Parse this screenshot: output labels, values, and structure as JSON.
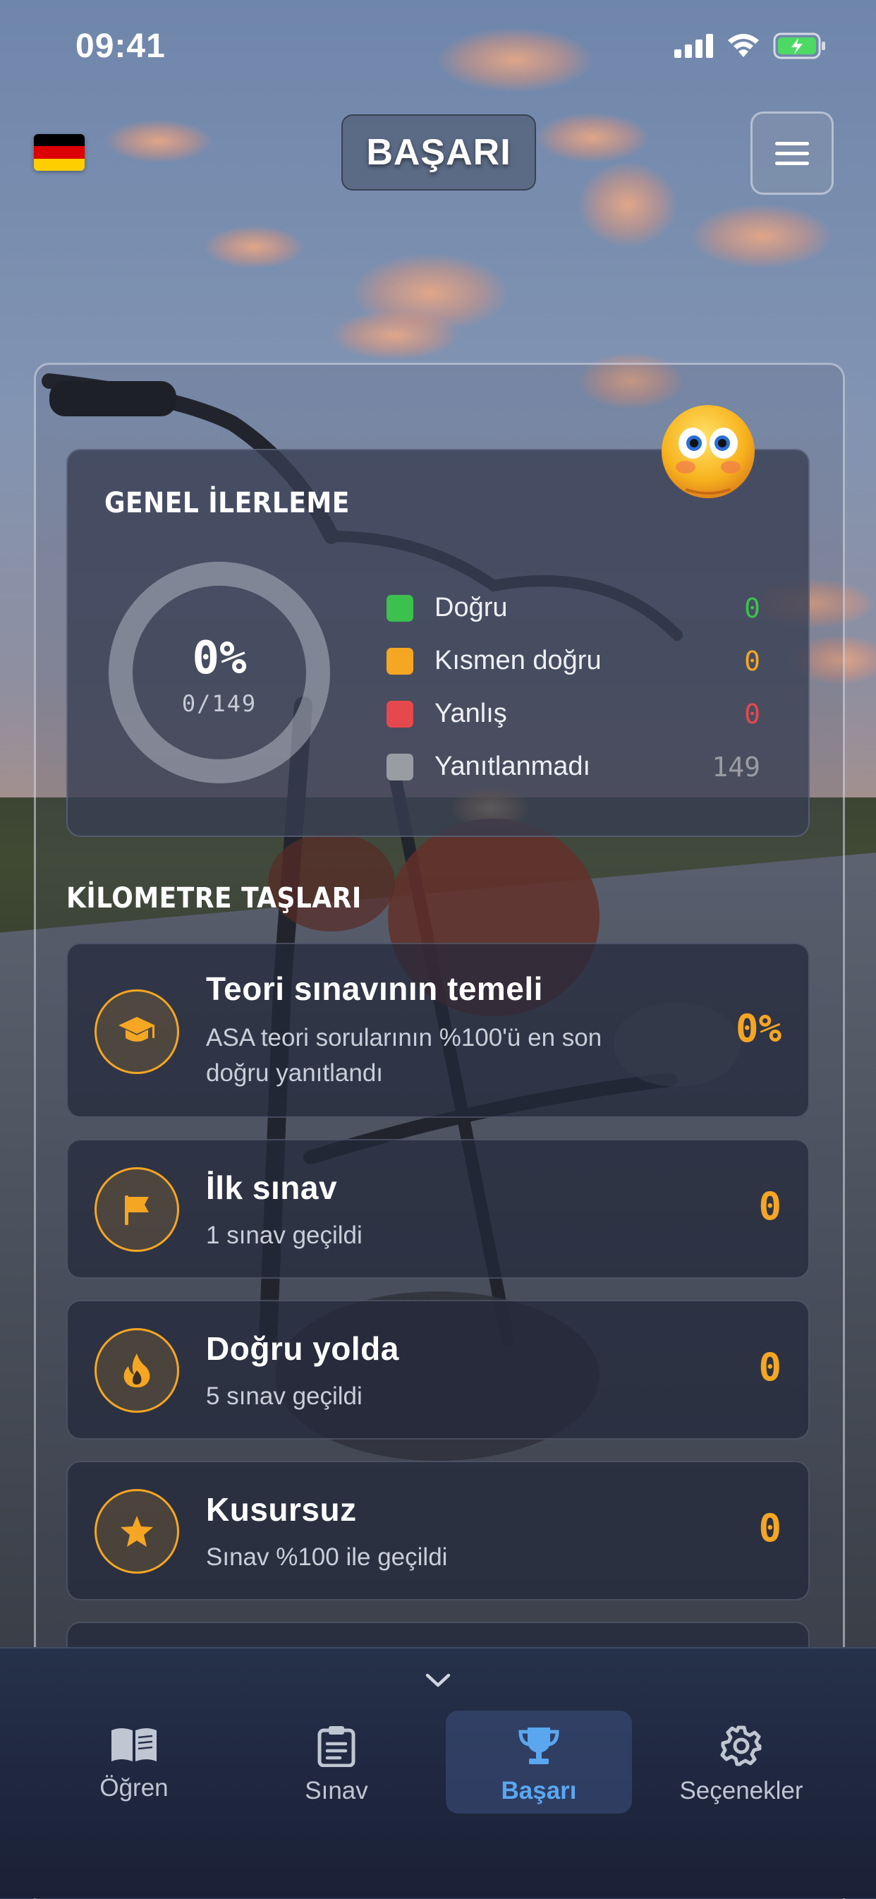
{
  "status_bar": {
    "time": "09:41"
  },
  "header": {
    "title": "BAŞARI"
  },
  "progress": {
    "title": "GENEL İLERLEME",
    "percent": "0%",
    "count": "0/149",
    "legend": [
      {
        "label": "Doğru",
        "value": "0",
        "color": "#3cc14f"
      },
      {
        "label": "Kısmen doğru",
        "value": "0",
        "color": "#f5a623"
      },
      {
        "label": "Yanlış",
        "value": "0",
        "color": "#e5484d"
      },
      {
        "label": "Yanıtlanmadı",
        "value": "149",
        "color": "#9a9ca3"
      }
    ]
  },
  "milestones": {
    "title": "KİLOMETRE TAŞLARI",
    "items": [
      {
        "title": "Teori sınavının temeli",
        "subtitle": "ASA teori sorularının %100'ü en son doğru yanıtlandı",
        "value": "0%",
        "icon": "graduation-cap-icon"
      },
      {
        "title": "İlk sınav",
        "subtitle": "1 sınav geçildi",
        "value": "0",
        "icon": "flag-icon"
      },
      {
        "title": "Doğru yolda",
        "subtitle": "5 sınav geçildi",
        "value": "0",
        "icon": "flame-icon"
      },
      {
        "title": "Kusursuz",
        "subtitle": "Sınav %100 ile geçildi",
        "value": "0",
        "icon": "star-icon"
      }
    ]
  },
  "nav": {
    "tabs": [
      {
        "label": "Öğren",
        "icon": "book-icon",
        "active": false
      },
      {
        "label": "Sınav",
        "icon": "clipboard-icon",
        "active": false
      },
      {
        "label": "Başarı",
        "icon": "trophy-icon",
        "active": true
      },
      {
        "label": "Seçenekler",
        "icon": "gear-icon",
        "active": false
      }
    ]
  },
  "colors": {
    "accent": "#f5a623",
    "active_tab": "#5aa7f0"
  }
}
